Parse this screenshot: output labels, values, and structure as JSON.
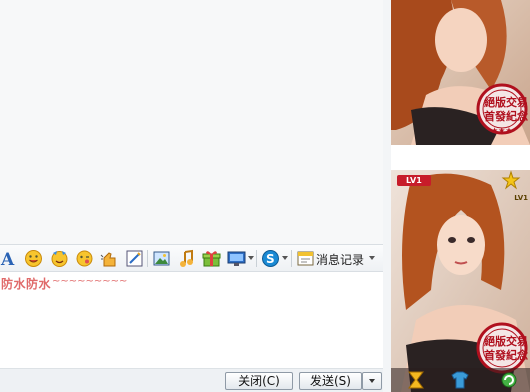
{
  "toolbar": {
    "icons": [
      "font-icon",
      "smiley-icon",
      "emoji-magic-icon",
      "wink-emoji-icon",
      "shake-icon",
      "screenshot-crop-icon",
      "image-icon",
      "music-icon",
      "gift-icon",
      "screen-share-icon",
      "payment-icon"
    ],
    "history_label": "消息记录"
  },
  "input": {
    "text": "防水防水",
    "squiggle": "~~~~~~~~~"
  },
  "buttons": {
    "close": "关闭(C)",
    "send": "发送(S)"
  },
  "profile": {
    "stamp_line1": "絕版交易",
    "stamp_line2": "首發紀念",
    "level_badge": "LV1",
    "level_badge_star": "LV1"
  },
  "colors": {
    "input_text": "#e06a6a",
    "stamp": "#b0101e"
  }
}
